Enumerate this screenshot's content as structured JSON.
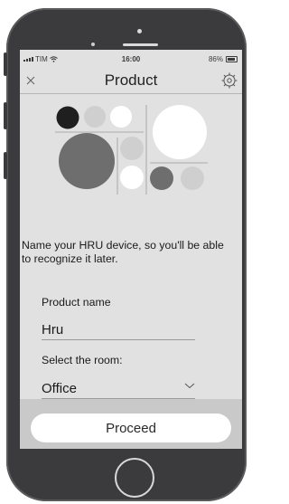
{
  "status": {
    "carrier": "TIM",
    "time": "16:00",
    "battery_text": "86%",
    "battery_level": 0.86
  },
  "header": {
    "title": "Product",
    "close_icon": "close-icon",
    "settings_icon": "gear-icon"
  },
  "intro": {
    "text": "Name your HRU device, so you'll be able to recognize it later."
  },
  "form": {
    "product_name_label": "Product name",
    "product_name_value": "Hru",
    "room_label": "Select the room:",
    "room_value": "Office"
  },
  "footer": {
    "proceed_label": "Proceed"
  },
  "colors": {
    "screen_bg": "#e1e1e1",
    "phone_body": "#3b3b3d",
    "bottom_bar": "#c9c9c9",
    "circle_black": "#1f1f1f",
    "circle_dark_gray": "#6e6e6e",
    "circle_light_gray": "#cfcfcf",
    "circle_white": "#ffffff"
  }
}
